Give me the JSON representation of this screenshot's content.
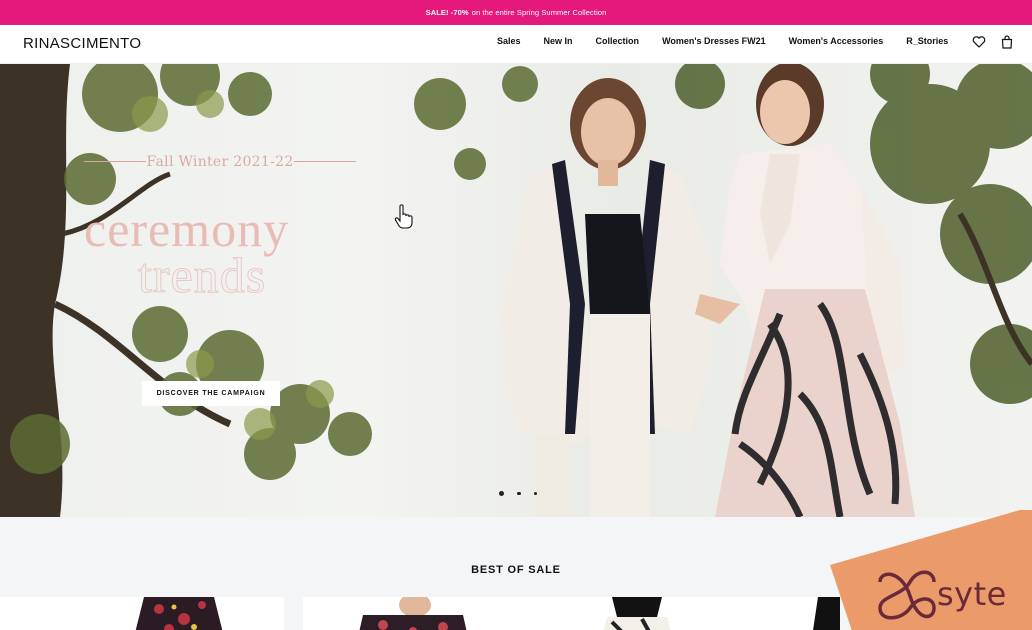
{
  "promo": {
    "bold": "SALE! -70%",
    "text": "on the entire Spring Summer Collection"
  },
  "header": {
    "logo": "RINASCIMENTO",
    "nav": [
      "Sales",
      "New In",
      "Collection",
      "Women's Dresses FW21",
      "Women's Accessories",
      "R_Stories"
    ],
    "icons": [
      "heart-icon",
      "shopping-bag-icon"
    ]
  },
  "hero": {
    "season": "Fall Winter 2021-22",
    "headline_1": "ceremony",
    "headline_2": "trends",
    "cta": "DISCOVER THE CAMPAIGN",
    "slides": 3,
    "active_slide": 1
  },
  "best_of_sale": {
    "title": "BEST OF SALE"
  },
  "badge": {
    "text": "syte"
  },
  "colors": {
    "promo_bg": "#e5197c",
    "accent_pink": "#e8bcb5",
    "badge_bg": "#eb9a6a",
    "badge_text": "#6b2a3a"
  }
}
